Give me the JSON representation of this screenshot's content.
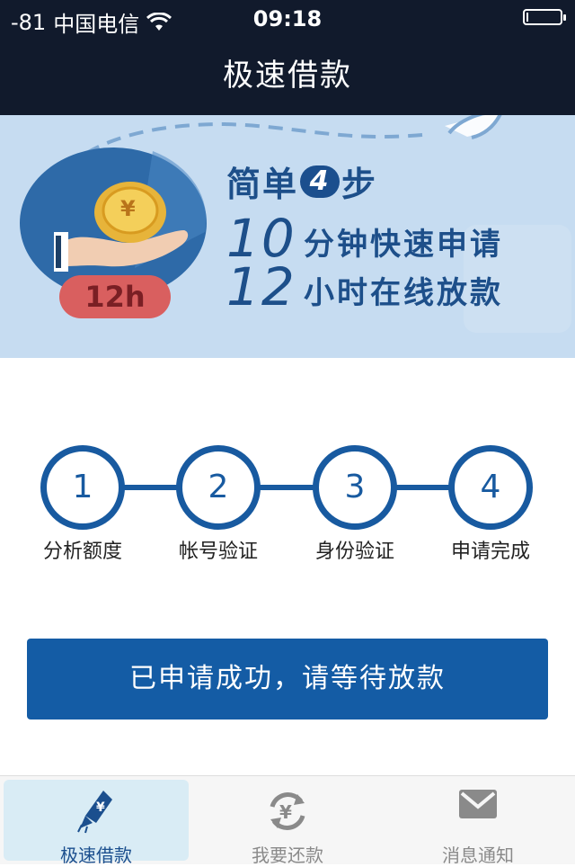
{
  "status_bar": {
    "signal": "-81",
    "carrier": "中国电信",
    "time": "09:18",
    "battery_level": 0.05
  },
  "nav": {
    "title": "极速借款"
  },
  "banner": {
    "badge": "12h",
    "currency_symbol": "¥",
    "headline_prefix": "简单",
    "headline_number": "4",
    "headline_suffix": "步",
    "features": [
      {
        "number": "10",
        "text": "分钟快速申请"
      },
      {
        "number": "12",
        "text": "小时在线放款"
      }
    ]
  },
  "steps": [
    {
      "number": "1",
      "label": "分析额度"
    },
    {
      "number": "2",
      "label": "帐号验证"
    },
    {
      "number": "3",
      "label": "身份验证"
    },
    {
      "number": "4",
      "label": "申请完成"
    }
  ],
  "action": {
    "label": "已申请成功，请等待放款"
  },
  "tabs": [
    {
      "label": "极速借款",
      "icon": "rocket-yen-icon",
      "active": true
    },
    {
      "label": "我要还款",
      "icon": "yen-cycle-icon",
      "active": false
    },
    {
      "label": "消息通知",
      "icon": "envelope-icon",
      "active": false
    }
  ],
  "colors": {
    "header_bg": "#111a2c",
    "banner_bg": "#c6dcf1",
    "brand_blue": "#185aa0",
    "button_blue": "#145ca5",
    "tab_active_bg": "#d9ecf5",
    "badge_red": "#d95f5f",
    "coin_gold": "#e7b43a"
  }
}
